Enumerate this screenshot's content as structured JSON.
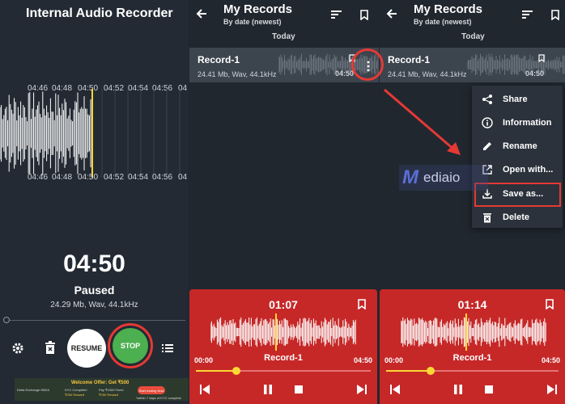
{
  "recorder": {
    "title": "Internal Audio Recorder",
    "axis_top": [
      "04:46",
      "04:48",
      "04:50",
      "04:52",
      "04:54",
      "04:56",
      "04"
    ],
    "axis_bottom": [
      "04:46",
      "04:48",
      "04:50",
      "04:52",
      "04:54",
      "04:56",
      "04"
    ],
    "elapsed": "04:50",
    "status": "Paused",
    "file_info": "24.29 Mb, Wav, 44.1kHz",
    "resume_label": "RESUME",
    "stop_label": "STOP"
  },
  "ad": {
    "title": "Welcome Offer: Get ₹500",
    "brand": "Delta Exchange INDIA",
    "item1_line1": "KYC Complete!",
    "item1_line2": "₹250 Reward",
    "item2_line1": "Pay ₹1000 Fees!",
    "item2_line2": "₹250 Reward",
    "cta": "Start trading Now",
    "footnote": "*within 7 days of KYC complete"
  },
  "records_list": {
    "title": "My Records",
    "subtitle": "By date (newest)",
    "section": "Today",
    "record": {
      "name": "Record-1",
      "info": "24.41 Mb, Wav, 44.1kHz",
      "duration": "04:50"
    }
  },
  "player_left": {
    "current": "01:07",
    "start": "00:00",
    "end": "04:50",
    "name": "Record-1",
    "progress": 0.23
  },
  "player_right": {
    "current": "01:14",
    "start": "00:00",
    "end": "04:50",
    "name": "Record-1",
    "progress": 0.26
  },
  "context_menu": {
    "items": [
      "Share",
      "Information",
      "Rename",
      "Open with...",
      "Save as...",
      "Delete"
    ]
  },
  "watermark": {
    "text": "ediaio"
  },
  "colors": {
    "background": "#1f2630",
    "player": "#c62828",
    "accent": "#fdd835",
    "stop": "#4caf50",
    "highlight": "#e53935"
  }
}
